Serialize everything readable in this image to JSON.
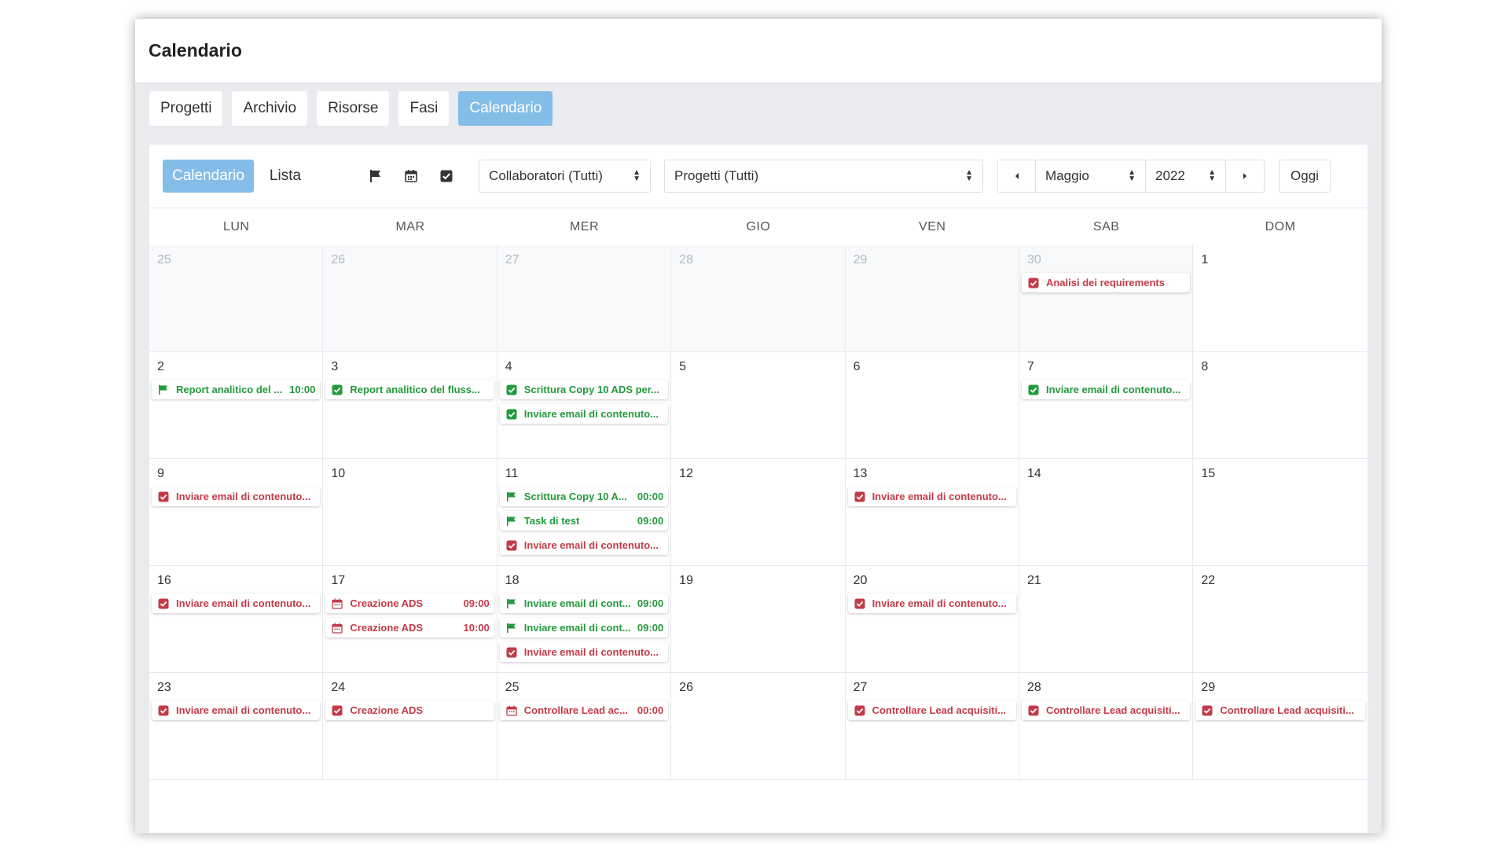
{
  "app": {
    "title": "Calendario"
  },
  "top_tabs": [
    {
      "label": "Progetti",
      "active": false
    },
    {
      "label": "Archivio",
      "active": false
    },
    {
      "label": "Risorse",
      "active": false
    },
    {
      "label": "Fasi",
      "active": false
    },
    {
      "label": "Calendario",
      "active": true
    }
  ],
  "toolbar": {
    "view_calendar": "Calendario",
    "view_list": "Lista",
    "filter_icons": [
      "flag-icon",
      "calendar-icon",
      "checkbox-icon"
    ],
    "collaborators_select": "Collaboratori (Tutti)",
    "projects_select": "Progetti (Tutti)",
    "prev_icon": "caret-left-icon",
    "month_select": "Maggio",
    "year_select": "2022",
    "next_icon": "caret-right-icon",
    "today_button": "Oggi"
  },
  "colors": {
    "accent": "#85bde9",
    "green": "#239a3b",
    "red": "#c33b48"
  },
  "weekdays": [
    "LUN",
    "MAR",
    "MER",
    "GIO",
    "VEN",
    "SAB",
    "DOM"
  ],
  "weeks": [
    [
      {
        "day": "25",
        "other": true,
        "events": []
      },
      {
        "day": "26",
        "other": true,
        "events": []
      },
      {
        "day": "27",
        "other": true,
        "events": []
      },
      {
        "day": "28",
        "other": true,
        "events": []
      },
      {
        "day": "29",
        "other": true,
        "events": []
      },
      {
        "day": "30",
        "other": true,
        "events": [
          {
            "icon": "checkbox-icon",
            "color": "red",
            "title": "Analisi dei requirements",
            "time": ""
          }
        ]
      },
      {
        "day": "1",
        "other": false,
        "events": []
      }
    ],
    [
      {
        "day": "2",
        "other": false,
        "events": [
          {
            "icon": "flag-icon",
            "color": "green",
            "title": "Report analitico del ...",
            "time": "10:00"
          }
        ]
      },
      {
        "day": "3",
        "other": false,
        "events": [
          {
            "icon": "checkbox-icon",
            "color": "green",
            "title": "Report analitico del fluss...",
            "time": ""
          }
        ]
      },
      {
        "day": "4",
        "other": false,
        "events": [
          {
            "icon": "checkbox-icon",
            "color": "green",
            "title": "Scrittura Copy 10 ADS per...",
            "time": ""
          },
          {
            "icon": "checkbox-icon",
            "color": "green",
            "title": "Inviare email di contenuto...",
            "time": ""
          }
        ]
      },
      {
        "day": "5",
        "other": false,
        "events": []
      },
      {
        "day": "6",
        "other": false,
        "events": []
      },
      {
        "day": "7",
        "other": false,
        "events": [
          {
            "icon": "checkbox-icon",
            "color": "green",
            "title": "Inviare email di contenuto...",
            "time": ""
          }
        ]
      },
      {
        "day": "8",
        "other": false,
        "events": []
      }
    ],
    [
      {
        "day": "9",
        "other": false,
        "events": [
          {
            "icon": "checkbox-icon",
            "color": "red",
            "title": "Inviare email di contenuto...",
            "time": ""
          }
        ]
      },
      {
        "day": "10",
        "other": false,
        "events": []
      },
      {
        "day": "11",
        "other": false,
        "events": [
          {
            "icon": "flag-icon",
            "color": "green",
            "title": "Scrittura Copy 10 A...",
            "time": "00:00"
          },
          {
            "icon": "flag-icon",
            "color": "green",
            "title": "Task di test",
            "time": "09:00"
          },
          {
            "icon": "checkbox-icon",
            "color": "red",
            "title": "Inviare email di contenuto...",
            "time": ""
          }
        ]
      },
      {
        "day": "12",
        "other": false,
        "events": []
      },
      {
        "day": "13",
        "other": false,
        "events": [
          {
            "icon": "checkbox-icon",
            "color": "red",
            "title": "Inviare email di contenuto...",
            "time": ""
          }
        ]
      },
      {
        "day": "14",
        "other": false,
        "events": []
      },
      {
        "day": "15",
        "other": false,
        "events": []
      }
    ],
    [
      {
        "day": "16",
        "other": false,
        "events": [
          {
            "icon": "checkbox-icon",
            "color": "red",
            "title": "Inviare email di contenuto...",
            "time": ""
          }
        ]
      },
      {
        "day": "17",
        "other": false,
        "events": [
          {
            "icon": "calendar-icon",
            "color": "red",
            "title": "Creazione ADS",
            "time": "09:00"
          },
          {
            "icon": "calendar-icon",
            "color": "red",
            "title": "Creazione ADS",
            "time": "10:00"
          }
        ]
      },
      {
        "day": "18",
        "other": false,
        "events": [
          {
            "icon": "flag-icon",
            "color": "green",
            "title": "Inviare email di cont...",
            "time": "09:00"
          },
          {
            "icon": "flag-icon",
            "color": "green",
            "title": "Inviare email di cont...",
            "time": "09:00"
          },
          {
            "icon": "checkbox-icon",
            "color": "red",
            "title": "Inviare email di contenuto...",
            "time": ""
          }
        ]
      },
      {
        "day": "19",
        "other": false,
        "events": []
      },
      {
        "day": "20",
        "other": false,
        "events": [
          {
            "icon": "checkbox-icon",
            "color": "red",
            "title": "Inviare email di contenuto...",
            "time": ""
          }
        ]
      },
      {
        "day": "21",
        "other": false,
        "events": []
      },
      {
        "day": "22",
        "other": false,
        "events": []
      }
    ],
    [
      {
        "day": "23",
        "other": false,
        "events": [
          {
            "icon": "checkbox-icon",
            "color": "red",
            "title": "Inviare email di contenuto...",
            "time": ""
          }
        ]
      },
      {
        "day": "24",
        "other": false,
        "events": [
          {
            "icon": "checkbox-icon",
            "color": "red",
            "title": "Creazione ADS",
            "time": ""
          }
        ]
      },
      {
        "day": "25",
        "other": false,
        "events": [
          {
            "icon": "calendar-icon",
            "color": "red",
            "title": "Controllare Lead ac...",
            "time": "00:00"
          }
        ]
      },
      {
        "day": "26",
        "other": false,
        "events": []
      },
      {
        "day": "27",
        "other": false,
        "events": [
          {
            "icon": "checkbox-icon",
            "color": "red",
            "title": "Controllare Lead acquisiti...",
            "time": ""
          }
        ]
      },
      {
        "day": "28",
        "other": false,
        "events": [
          {
            "icon": "checkbox-icon",
            "color": "red",
            "title": "Controllare Lead acquisiti...",
            "time": ""
          }
        ]
      },
      {
        "day": "29",
        "other": false,
        "events": [
          {
            "icon": "checkbox-icon",
            "color": "red",
            "title": "Controllare Lead acquisiti...",
            "time": ""
          }
        ]
      }
    ]
  ]
}
